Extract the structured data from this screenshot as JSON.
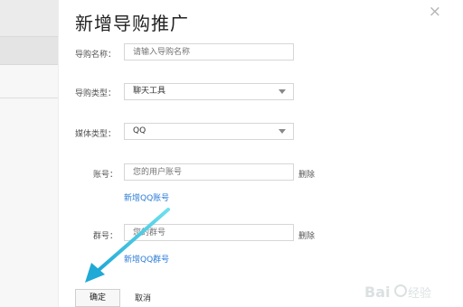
{
  "modal": {
    "title": "新增导购推广",
    "close_label": "×"
  },
  "form": {
    "name": {
      "label": "导购名称：",
      "placeholder": "请输入导购名称"
    },
    "guide_type": {
      "label": "导购类型：",
      "value": "聊天工具"
    },
    "media_type": {
      "label": "媒体类型：",
      "value": "QQ"
    },
    "account": {
      "label": "账号：",
      "placeholder": "您的用户账号",
      "delete_label": "删除",
      "add_link": "新增QQ账号"
    },
    "group": {
      "label": "群号：",
      "placeholder": "您的群号",
      "delete_label": "删除",
      "add_link": "新增QQ群号"
    }
  },
  "actions": {
    "confirm_label": "确定",
    "cancel_label": "取消"
  },
  "colors": {
    "link": "#2a7bd6",
    "annotation_arrow": "#33c4dc"
  },
  "watermark": {
    "text": "Baidu 经验"
  }
}
